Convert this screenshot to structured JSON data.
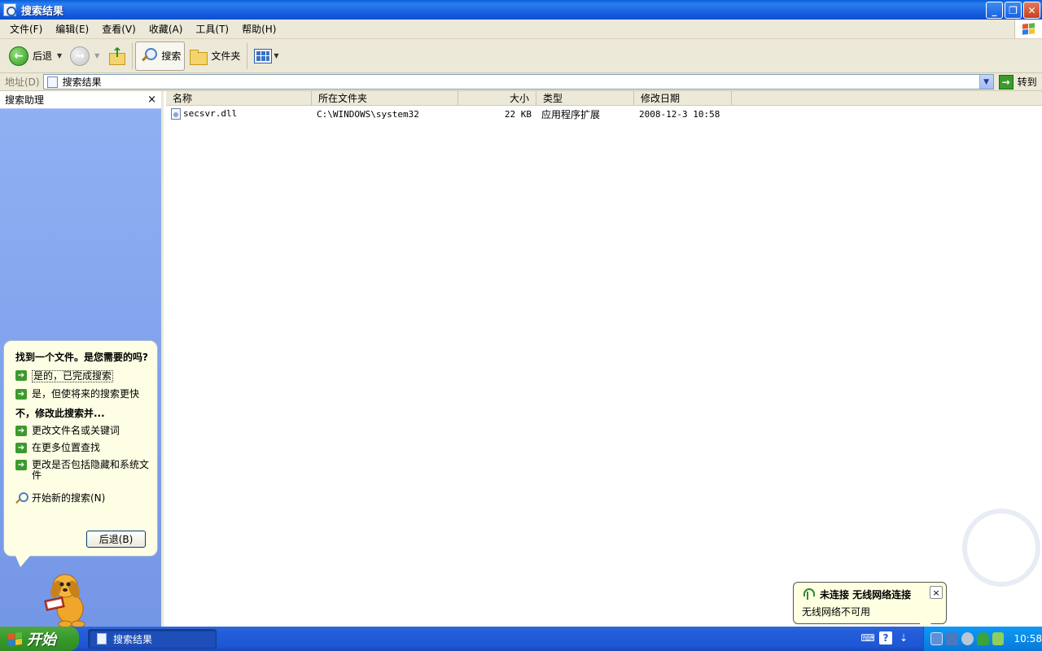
{
  "window": {
    "title": "搜索结果"
  },
  "menu": [
    "文件(F)",
    "编辑(E)",
    "查看(V)",
    "收藏(A)",
    "工具(T)",
    "帮助(H)"
  ],
  "toolbar": {
    "back": "后退",
    "search": "搜索",
    "folders": "文件夹"
  },
  "address": {
    "label": "地址(D)",
    "value": "搜索结果",
    "go": "转到"
  },
  "search_pane": {
    "title": "搜索助理",
    "close": "×",
    "heading": "找到一个文件。是您需要的吗?",
    "yes_done": "是的，已完成搜索",
    "yes_faster": "是，但使将来的搜索更快",
    "no_modify": "不，修改此搜索并...",
    "change_name": "更改文件名或关键词",
    "more_locations": "在更多位置查找",
    "change_hidden": "更改是否包括隐藏和系统文件",
    "new_search": "开始新的搜索(N)",
    "back_button": "后退(B)"
  },
  "columns": [
    "名称",
    "所在文件夹",
    "大小",
    "类型",
    "修改日期"
  ],
  "files": [
    {
      "name": "secsvr.dll",
      "folder": "C:\\WINDOWS\\system32",
      "size": "22 KB",
      "type": "应用程序扩展",
      "modified": "2008-12-3 10:58"
    }
  ],
  "notification": {
    "title": "未连接 无线网络连接",
    "body": "无线网络不可用",
    "close": "×"
  },
  "taskbar": {
    "start": "开始",
    "task": "搜索结果",
    "clock": "10:58"
  },
  "colors": {
    "title_bar": "#0a5fd8",
    "taskbar": "#245edb",
    "start_button": "#379a2a",
    "pane_bg": "#7c9de8"
  }
}
